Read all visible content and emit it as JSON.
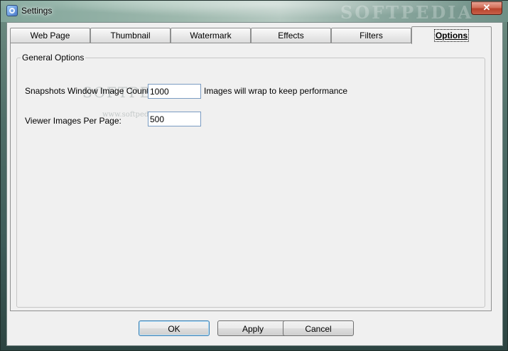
{
  "window": {
    "title": "Settings",
    "watermark": "SOFTPEDIA",
    "close_glyph": "✕"
  },
  "tabs": [
    {
      "label": "Web Page",
      "active": false
    },
    {
      "label": "Thumbnail",
      "active": false
    },
    {
      "label": "Watermark",
      "active": false
    },
    {
      "label": "Effects",
      "active": false
    },
    {
      "label": "Filters",
      "active": false
    },
    {
      "label": "Options",
      "active": true
    }
  ],
  "general_options": {
    "legend": "General Options",
    "snapshots": {
      "label": "Snapshots Window Image Count:",
      "value": "1000",
      "hint": "Images will wrap to keep performance"
    },
    "viewer": {
      "label": "Viewer Images Per Page:",
      "value": "500"
    },
    "watermark_overlay": "SOFTPEDIA",
    "watermark_url": "www.softpedia.com"
  },
  "buttons": {
    "ok": "OK",
    "apply": "Apply",
    "cancel": "Cancel"
  },
  "colors": {
    "dialog_bg": "#f0f0f0",
    "textbox_border": "#7a9cc2",
    "close_button": "#c8604a"
  }
}
